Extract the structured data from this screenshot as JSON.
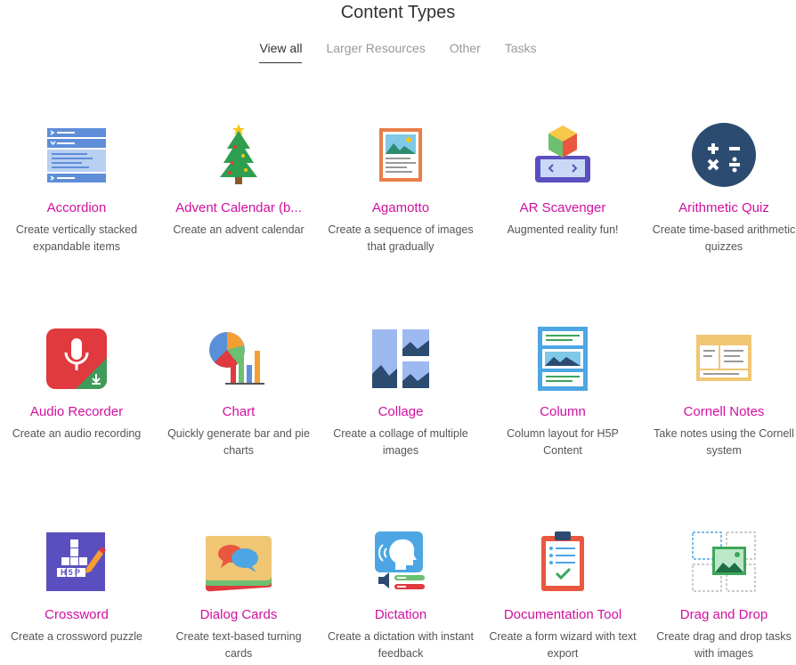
{
  "header": {
    "title": "Content Types"
  },
  "tabs": [
    "View all",
    "Larger Resources",
    "Other",
    "Tasks"
  ],
  "items": [
    {
      "name": "Accordion",
      "desc": "Create vertically stacked expandable items",
      "icon": "accordion-icon"
    },
    {
      "name": "Advent Calendar (b...",
      "desc": "Create an advent calendar",
      "icon": "advent-calendar-icon"
    },
    {
      "name": "Agamotto",
      "desc": "Create a sequence of images that gradually",
      "icon": "agamotto-icon"
    },
    {
      "name": "AR Scavenger",
      "desc": "Augmented reality fun!",
      "icon": "ar-scavenger-icon"
    },
    {
      "name": "Arithmetic Quiz",
      "desc": "Create time-based arithmetic quizzes",
      "icon": "arithmetic-quiz-icon"
    },
    {
      "name": "Audio Recorder",
      "desc": "Create an audio recording",
      "icon": "audio-recorder-icon"
    },
    {
      "name": "Chart",
      "desc": "Quickly generate bar and pie charts",
      "icon": "chart-icon"
    },
    {
      "name": "Collage",
      "desc": "Create a collage of multiple images",
      "icon": "collage-icon"
    },
    {
      "name": "Column",
      "desc": "Column layout for H5P Content",
      "icon": "column-icon"
    },
    {
      "name": "Cornell Notes",
      "desc": "Take notes using the Cornell system",
      "icon": "cornell-notes-icon"
    },
    {
      "name": "Crossword",
      "desc": "Create a crossword puzzle",
      "icon": "crossword-icon"
    },
    {
      "name": "Dialog Cards",
      "desc": "Create text-based turning cards",
      "icon": "dialog-cards-icon"
    },
    {
      "name": "Dictation",
      "desc": "Create a dictation with instant feedback",
      "icon": "dictation-icon"
    },
    {
      "name": "Documentation Tool",
      "desc": "Create a form wizard with text export",
      "icon": "documentation-tool-icon"
    },
    {
      "name": "Drag and Drop",
      "desc": "Create drag and drop tasks with images",
      "icon": "drag-and-drop-icon"
    }
  ],
  "crossword_icon_text": "H5P"
}
